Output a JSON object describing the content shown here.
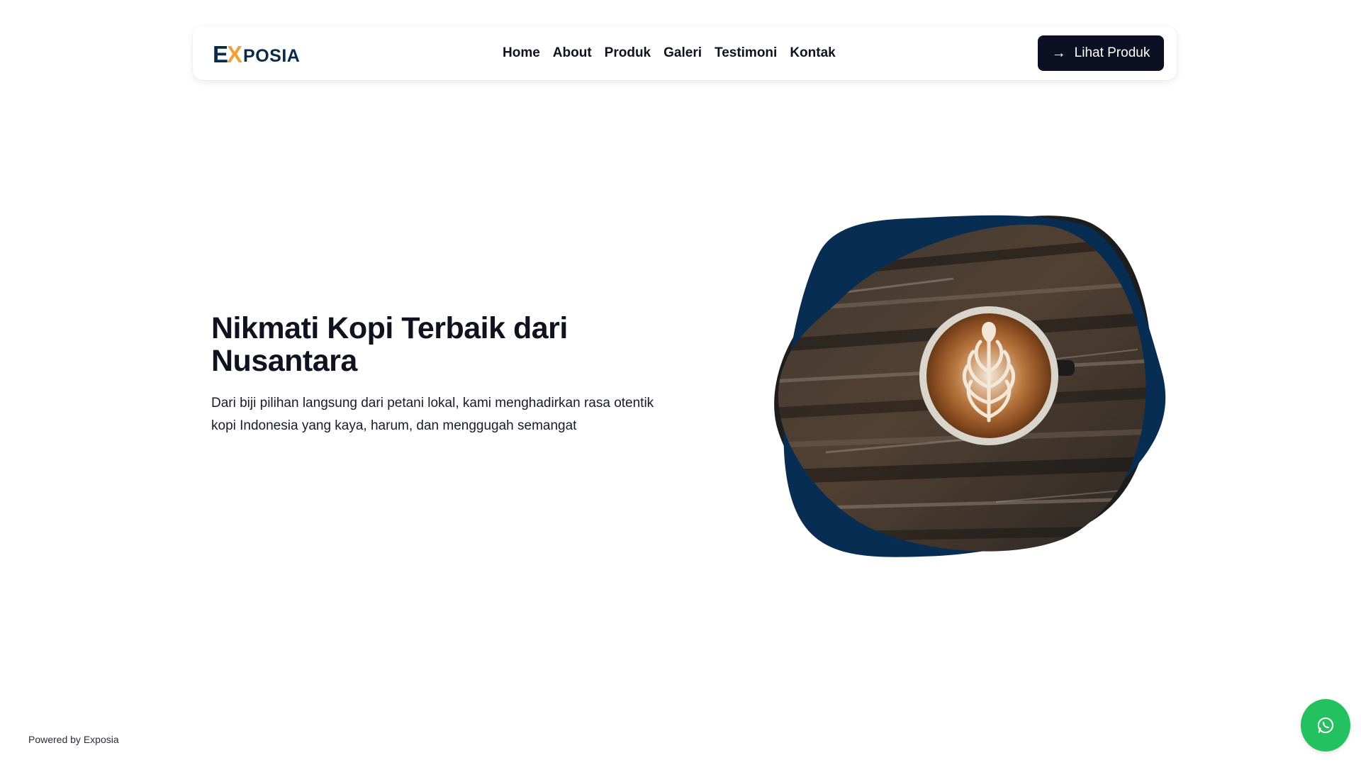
{
  "logo": {
    "part1": "E",
    "part2": "X",
    "part3": "POSIA"
  },
  "nav": {
    "links": [
      "Home",
      "About",
      "Produk",
      "Galeri",
      "Testimoni",
      "Kontak"
    ],
    "cta_label": "Lihat Produk",
    "cta_icon": "arrow-right-icon"
  },
  "hero": {
    "title": "Nikmati Kopi Terbaik dari Nusantara",
    "description": "Dari biji pilihan langsung dari petani lokal, kami menghadirkan rasa otentik kopi Indonesia yang kaya, harum, dan menggugah semangat",
    "image_subject": "coffee-latte-on-wooden-table"
  },
  "footer": {
    "powered_by": "Powered by Exposia"
  },
  "whatsapp": {
    "icon": "whatsapp-icon"
  },
  "colors": {
    "brand_navy": "#0a2a4a",
    "brand_orange": "#f0a23a",
    "cta_bg": "#0d0f22",
    "blob_blue": "#072d52",
    "whatsapp_green": "#23c15f"
  }
}
